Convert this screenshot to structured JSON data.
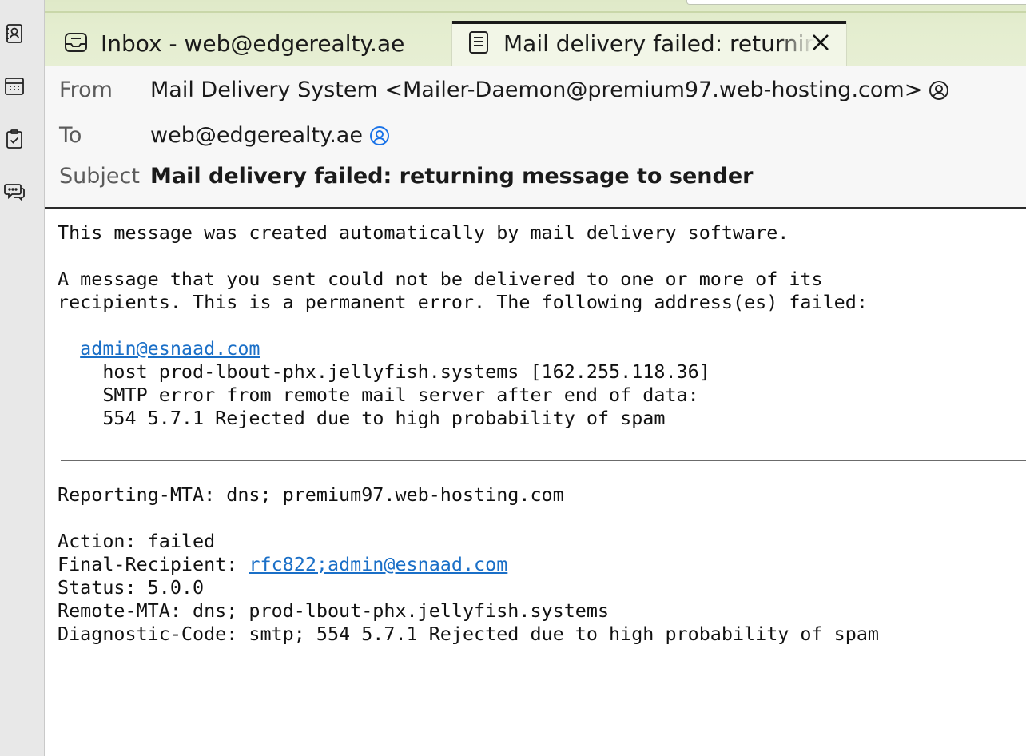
{
  "tabs": [
    {
      "label": "Inbox - web@edgerealty.ae",
      "icon": "inbox-icon"
    },
    {
      "label": "Mail delivery failed: returning message to sender",
      "icon": "message-icon"
    }
  ],
  "spaces": [
    "address-book-icon",
    "calendar-icon",
    "tasks-icon",
    "chat-icon"
  ],
  "header": {
    "from_label": "From",
    "from_value": "Mail Delivery System <Mailer-Daemon@premium97.web-hosting.com>",
    "to_label": "To",
    "to_value": "web@edgerealty.ae",
    "subject_label": "Subject",
    "subject_value": "Mail delivery failed: returning message to sender"
  },
  "body": {
    "intro": "This message was created automatically by mail delivery software.",
    "p1_line1": "A message that you sent could not be delivered to one or more of its",
    "p1_line2": "recipients. This is a permanent error. The following address(es) failed:",
    "failed_address": "admin@esnaad.com",
    "detail1": "host prod-lbout-phx.jellyfish.systems [162.255.118.36]",
    "detail2": "SMTP error from remote mail server after end of data:",
    "detail3": "554 5.7.1 Rejected due to high probability of spam"
  },
  "report": {
    "reporting_mta": "Reporting-MTA: dns; premium97.web-hosting.com",
    "action": "Action: failed",
    "final_recipient_label": "Final-Recipient: ",
    "final_recipient_link": "rfc822;admin@esnaad.com",
    "status": "Status: 5.0.0",
    "remote_mta": "Remote-MTA: dns; prod-lbout-phx.jellyfish.systems",
    "diagnostic": "Diagnostic-Code: smtp; 554 5.7.1 Rejected due to high probability of spam"
  },
  "colors": {
    "link": "#1a6fc7",
    "tabstrip": "#e4edcf",
    "contact_icon_to": "#1a73e8"
  }
}
